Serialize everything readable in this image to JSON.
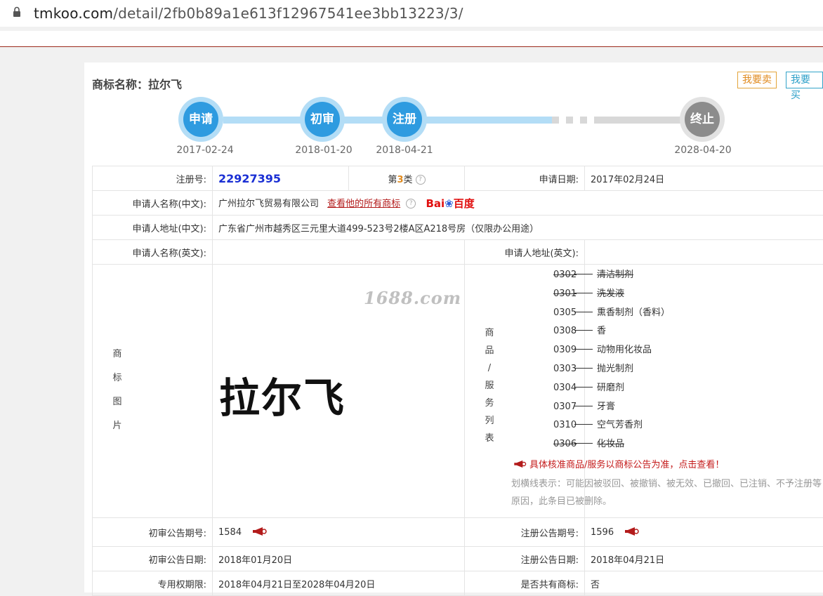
{
  "browser": {
    "url_host": "tmkoo.com",
    "url_path": "/detail/2fb0b89a1e613f12967541ee3bb13223/3/"
  },
  "trademark": {
    "title_label": "商标名称：",
    "title_value": "拉尔飞",
    "sell_button": "我要卖",
    "buy_button": "我要买"
  },
  "progress": {
    "steps": [
      {
        "label": "申请",
        "date": "2017-02-24",
        "state": "done"
      },
      {
        "label": "初审",
        "date": "2018-01-20",
        "state": "done"
      },
      {
        "label": "注册",
        "date": "2018-04-21",
        "state": "done"
      },
      {
        "label": "终止",
        "date": "2028-04-20",
        "state": "future"
      }
    ]
  },
  "table": {
    "reg_no_label": "注册号:",
    "reg_no": "22927395",
    "class_prefix": "第",
    "class_num": "3",
    "class_suffix": "类",
    "class_help": "?",
    "apply_date_label": "申请日期:",
    "apply_date": "2017年02月24日",
    "applicant_cn_label": "申请人名称(中文):",
    "applicant_cn": "广州拉尔飞贸易有限公司",
    "view_all_link": "查看他的所有商标",
    "applicant_help": "?",
    "baidu_1": "Bai",
    "baidu_2": "百度",
    "address_cn_label": "申请人地址(中文):",
    "address_cn": "广东省广州市越秀区三元里大道499-523号2楼A区A218号房（仅限办公用途）",
    "applicant_en_label": "申请人名称(英文):",
    "applicant_en": "",
    "address_en_label": "申请人地址(英文):",
    "address_en": "",
    "image_label": [
      "商",
      "标",
      "图",
      "片"
    ],
    "image_watermark": "1688.com",
    "image_text": "拉尔飞",
    "goods_label": [
      "商",
      "品",
      "/",
      "服",
      "务",
      "列",
      "表"
    ],
    "goods": [
      {
        "code": "0302",
        "name": "清洁制剂",
        "struck": true
      },
      {
        "code": "0301",
        "name": "洗发液",
        "struck": true
      },
      {
        "code": "0305",
        "name": "熏香制剂（香料）",
        "struck": false
      },
      {
        "code": "0308",
        "name": "香",
        "struck": false
      },
      {
        "code": "0309",
        "name": "动物用化妆品",
        "struck": false
      },
      {
        "code": "0303",
        "name": "抛光制剂",
        "struck": false
      },
      {
        "code": "0304",
        "name": "研磨剂",
        "struck": false
      },
      {
        "code": "0307",
        "name": "牙膏",
        "struck": false
      },
      {
        "code": "0310",
        "name": "空气芳香剂",
        "struck": false
      },
      {
        "code": "0306",
        "name": "化妆品",
        "struck": true
      }
    ],
    "goods_notice": "具体核准商品/服务以商标公告为准，点击查看！",
    "strike_note": "划横线表示：可能因被驳回、被撤销、被无效、已撤回、已注销、不予注册等原因，此条目已被删除。",
    "prelim_pub_no_label": "初审公告期号:",
    "prelim_pub_no": "1584",
    "reg_pub_no_label": "注册公告期号:",
    "reg_pub_no": "1596",
    "prelim_pub_date_label": "初审公告日期:",
    "prelim_pub_date": "2018年01月20日",
    "reg_pub_date_label": "注册公告日期:",
    "reg_pub_date": "2018年04月21日",
    "exclusive_period_label": "专用权期限:",
    "exclusive_period": "2018年04月21日至2028年04月20日",
    "shared_label": "是否共有商标:",
    "shared": "否"
  },
  "colors": {
    "step_blue": "#2e9be0",
    "step_gray": "#8c8c8c",
    "reg_no_blue": "#1a2fd4",
    "link_red": "#b31b1b"
  }
}
